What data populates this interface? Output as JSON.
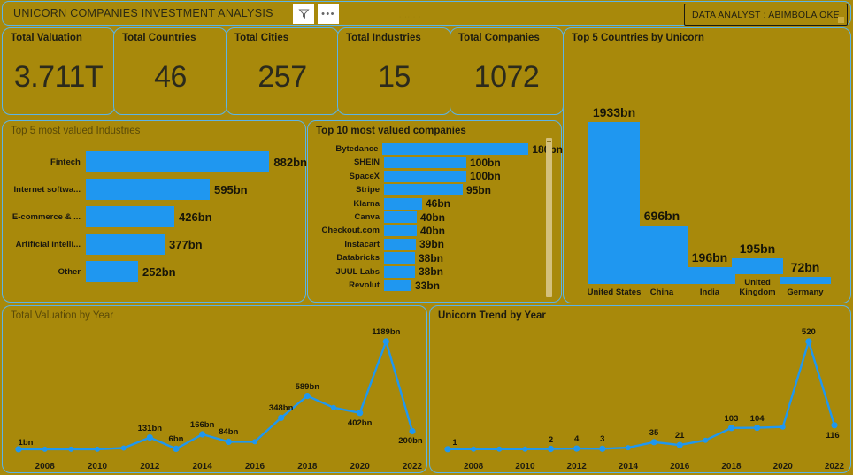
{
  "header": {
    "title": "UNICORN COMPANIES INVESTMENT ANALYSIS",
    "filter_icon": "filter-icon",
    "more_icon": "more-options-icon",
    "ghost_text": "· ·· · ·",
    "analyst_label": "DATA ANALYST : ABIMBOLA OKE"
  },
  "theme": {
    "background": "#a8890b",
    "border": "#5bb4e8",
    "accent": "#1f97f0",
    "text": "#1d1b10"
  },
  "kpis": [
    {
      "title": "Total Valuation",
      "value": "3.711T"
    },
    {
      "title": "Total Countries",
      "value": "46"
    },
    {
      "title": "Total Cities",
      "value": "257"
    },
    {
      "title": "Total Industries",
      "value": "15"
    },
    {
      "title": "Total Companies",
      "value": "1072"
    }
  ],
  "chart_data": [
    {
      "id": "countries",
      "type": "bar",
      "orientation": "vertical",
      "title": "Top 5 Countries by Unicorn",
      "xlabel": "",
      "ylabel": "",
      "categories": [
        "United States",
        "China",
        "India",
        "United Kingdom",
        "Germany"
      ],
      "values": [
        1933,
        696,
        196,
        195,
        72
      ],
      "labels": [
        "1933bn",
        "696bn",
        "196bn",
        "195bn",
        "72bn"
      ],
      "ylim": [
        0,
        1933
      ],
      "grid": false,
      "legend": "none",
      "unit": "bn"
    },
    {
      "id": "industries",
      "type": "bar",
      "orientation": "horizontal",
      "title": "Top 5 most valued Industries",
      "xlabel": "",
      "ylabel": "",
      "categories": [
        "Fintech",
        "Internet softwa...",
        "E-commerce & ...",
        "Artificial intelli...",
        "Other"
      ],
      "values": [
        882,
        595,
        426,
        377,
        252
      ],
      "labels": [
        "882bn",
        "595bn",
        "426bn",
        "377bn",
        "252bn"
      ],
      "xlim": [
        0,
        882
      ],
      "grid": false,
      "legend": "none",
      "unit": "bn"
    },
    {
      "id": "companies",
      "type": "bar",
      "orientation": "horizontal",
      "title": "Top 10 most valued companies",
      "xlabel": "",
      "ylabel": "",
      "categories": [
        "Bytedance",
        "SHEIN",
        "SpaceX",
        "Stripe",
        "Klarna",
        "Canva",
        "Checkout.com",
        "Instacart",
        "Databricks",
        "JUUL Labs",
        "Revolut"
      ],
      "values": [
        180,
        100,
        100,
        95,
        46,
        40,
        40,
        39,
        38,
        38,
        33
      ],
      "labels": [
        "180bn",
        "100bn",
        "100bn",
        "95bn",
        "46bn",
        "40bn",
        "40bn",
        "39bn",
        "38bn",
        "38bn",
        "33bn"
      ],
      "xlim": [
        0,
        180
      ],
      "grid": false,
      "legend": "none",
      "unit": "bn",
      "scrollable": true
    },
    {
      "id": "valyear",
      "type": "line",
      "title": "Total Valuation by Year",
      "xlabel": "",
      "ylabel": "",
      "x": [
        2007,
        2008,
        2009,
        2010,
        2011,
        2012,
        2013,
        2014,
        2015,
        2016,
        2017,
        2018,
        2019,
        2020,
        2021,
        2022
      ],
      "values": [
        1,
        1,
        1,
        1,
        15,
        131,
        6,
        166,
        84,
        84,
        348,
        589,
        460,
        402,
        1189,
        200
      ],
      "point_labels": {
        "2007": "1bn",
        "2012": "131bn",
        "2013": "6bn",
        "2014": "166bn",
        "2015": "84bn",
        "2017": "348bn",
        "2018": "589bn",
        "2020": "402bn",
        "2021": "1189bn",
        "2022": "200bn"
      },
      "ticks": [
        "2008",
        "2010",
        "2012",
        "2014",
        "2016",
        "2018",
        "2020",
        "2022"
      ],
      "ylim": [
        0,
        1189
      ],
      "grid": false,
      "legend": "none",
      "unit": "bn"
    },
    {
      "id": "trendyear",
      "type": "line",
      "title": "Unicorn Trend by Year",
      "xlabel": "",
      "ylabel": "",
      "x": [
        2007,
        2008,
        2009,
        2010,
        2011,
        2012,
        2013,
        2014,
        2015,
        2016,
        2017,
        2018,
        2019,
        2020,
        2021,
        2022
      ],
      "values": [
        1,
        1,
        1,
        1,
        2,
        4,
        3,
        8,
        35,
        21,
        44,
        103,
        104,
        108,
        520,
        116
      ],
      "point_labels": {
        "2007": "1",
        "2011": "2",
        "2012": "4",
        "2013": "3",
        "2015": "35",
        "2016": "21",
        "2018": "103",
        "2019": "104",
        "2021": "520",
        "2022": "116"
      },
      "ticks": [
        "2008",
        "2010",
        "2012",
        "2014",
        "2016",
        "2018",
        "2020",
        "2022"
      ],
      "ylim": [
        0,
        520
      ],
      "grid": false,
      "legend": "none",
      "unit": ""
    }
  ]
}
